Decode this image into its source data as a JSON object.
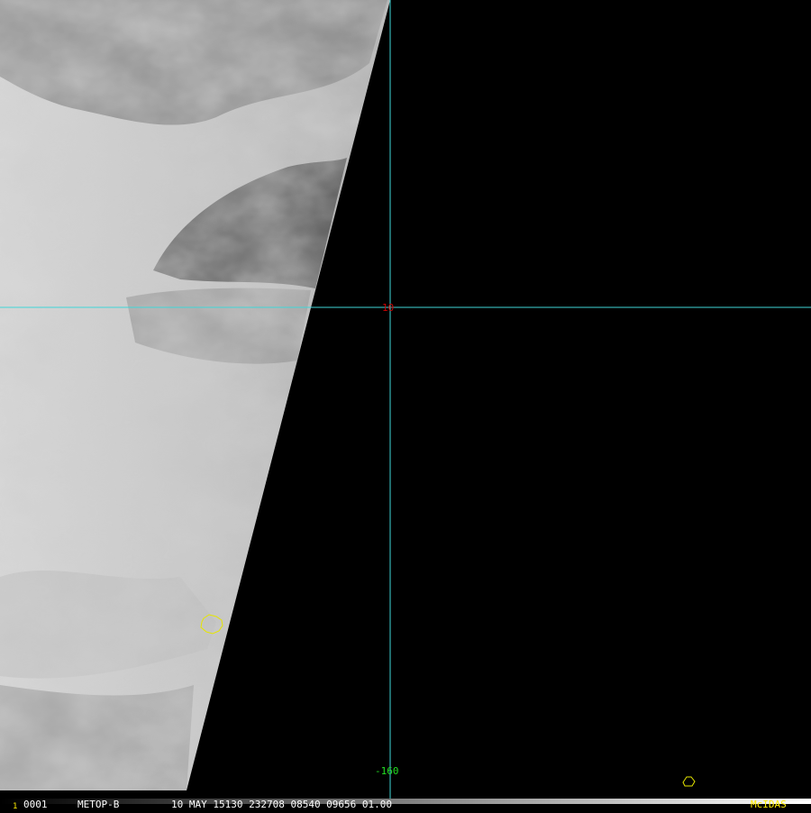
{
  "image": {
    "satellite": "METOP-B",
    "frame_number": "1",
    "frame_id": "0001",
    "timestamp": "10 MAY 15130 232708 08540 09656 01.00",
    "software": "McIDAS"
  },
  "grid": {
    "latitude_label": "10",
    "longitude_label": "-160"
  },
  "colors": {
    "grid_line": "#3fd6d8",
    "lat_label": "#d00000",
    "lon_label": "#22dd22",
    "coastline": "#e6e600",
    "status_text": "#ffffff",
    "frame_number": "#ffee00",
    "software": "#ffee00",
    "background": "#000000"
  }
}
